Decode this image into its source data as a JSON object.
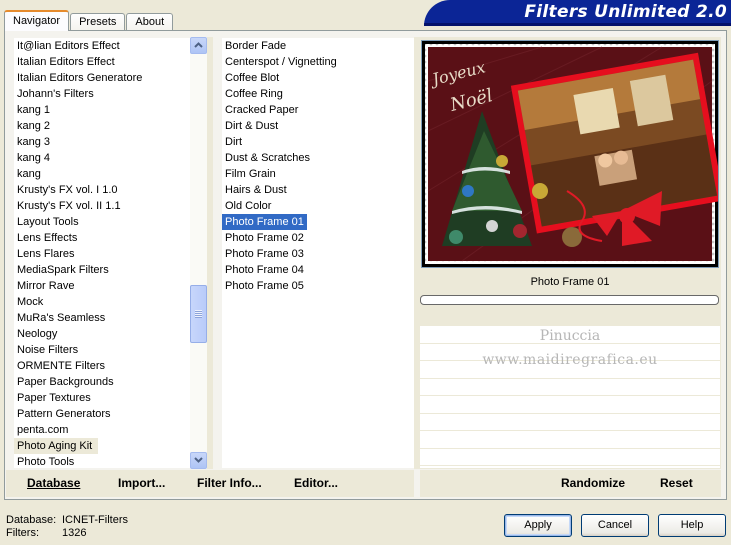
{
  "tabs": [
    {
      "label": "Navigator",
      "active": true
    },
    {
      "label": "Presets"
    },
    {
      "label": "About"
    }
  ],
  "banner": {
    "title": "Filters Unlimited 2.0"
  },
  "categories": {
    "items": [
      "It@lian Editors Effect",
      "Italian Editors Effect",
      "Italian Editors Generatore",
      "Johann's Filters",
      "kang 1",
      "kang 2",
      "kang 3",
      "kang 4",
      "kang",
      "Krusty's FX vol. I 1.0",
      "Krusty's FX vol. II 1.1",
      "Layout Tools",
      "Lens Effects",
      "Lens Flares",
      "MediaSpark Filters",
      "Mirror Rave",
      "Mock",
      "MuRa's Seamless",
      "Neology",
      "Noise Filters",
      "ORMENTE Filters",
      "Paper Backgrounds",
      "Paper Textures",
      "Pattern Generators",
      "penta.com",
      "Photo Aging Kit",
      "Photo Tools"
    ],
    "highlighted": "Photo Aging Kit"
  },
  "filters": {
    "items": [
      "Border Fade",
      "Centerspot / Vignetting",
      "Coffee Blot",
      "Coffee Ring",
      "Cracked Paper",
      "Dirt & Dust",
      "Dirt",
      "Dust & Scratches",
      "Film Grain",
      "Hairs & Dust",
      "Old Color",
      "Photo Frame 01",
      "Photo Frame 02",
      "Photo Frame 03",
      "Photo Frame 04",
      "Photo Frame 05"
    ],
    "selected": "Photo Frame 01"
  },
  "preview": {
    "filter_name": "Photo Frame 01",
    "greeting_line1": "Joyeux",
    "greeting_line2": "Noël",
    "progress": 0
  },
  "watermark": {
    "line1": "Pinuccia",
    "line2": "www.maidiregrafica.eu"
  },
  "toolbar": {
    "database": "Database",
    "import": "Import...",
    "filter_info": "Filter Info...",
    "editor": "Editor...",
    "randomize": "Randomize",
    "reset": "Reset"
  },
  "footer": {
    "database_label": "Database:",
    "database_value": "ICNET-Filters",
    "filters_label": "Filters:",
    "filters_value": "1326",
    "apply": "Apply",
    "cancel": "Cancel",
    "help": "Help"
  },
  "colors": {
    "selection": "#316ac5",
    "banner": "#0b2596",
    "tab_accent": "#e68b2c"
  }
}
